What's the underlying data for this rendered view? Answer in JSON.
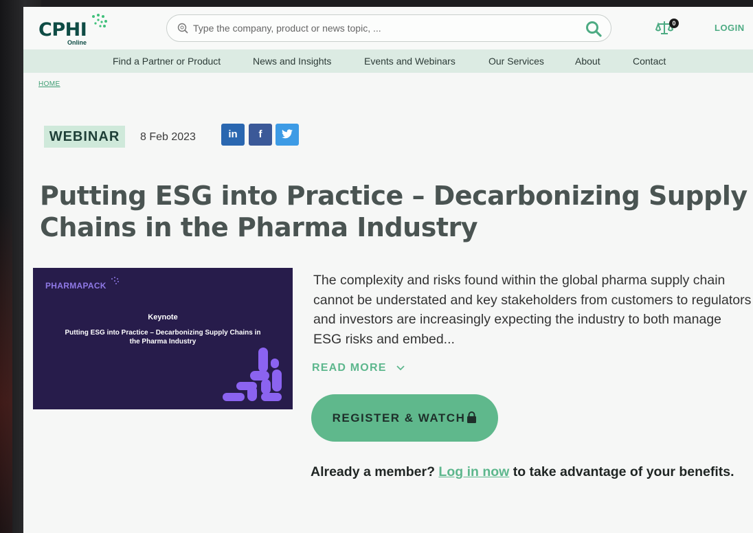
{
  "header": {
    "logo_text": "CPHI",
    "logo_sub": "Online",
    "search_placeholder": "Type the company, product or news topic, ...",
    "cart_count": "0",
    "login_label": "LOGIN"
  },
  "nav": {
    "items": [
      {
        "label": "Find a Partner or Product"
      },
      {
        "label": "News and Insights"
      },
      {
        "label": "Events and Webinars"
      },
      {
        "label": "Our Services"
      },
      {
        "label": "About"
      },
      {
        "label": "Contact"
      }
    ]
  },
  "breadcrumb": {
    "home": "HOME"
  },
  "article": {
    "tag": "WEBINAR",
    "date": "8 Feb 2023",
    "share": {
      "linkedin": "in",
      "facebook": "f"
    },
    "title": "Putting ESG into Practice – Decarbonizing Supply Chains in the Pharma Industry",
    "thumbnail": {
      "brand": "PHARMAPACK",
      "kicker": "Keynote",
      "title": "Putting ESG into Practice – Decarbonizing Supply Chains in the Pharma Industry"
    },
    "description": "The complexity and risks found within the global pharma supply chain cannot be understated and key stakeholders from customers to regulators and investors are increasingly expecting the industry to both manage ESG risks and embed...",
    "read_more": "READ MORE",
    "register_label": "REGISTER & WATCH",
    "member_prefix": "Already a member?",
    "member_link": "Log in now",
    "member_suffix": "to take advantage of your benefits."
  },
  "colors": {
    "brand_dark": "#0f4c45",
    "accent_green": "#5fb88c",
    "nav_bg": "#dcebe3",
    "thumb_bg": "#271c4b",
    "thumb_accent": "#8f79e6"
  },
  "icons": [
    "search-icon",
    "magnifier-button-icon",
    "cart-scale-icon",
    "linkedin-icon",
    "facebook-icon",
    "twitter-icon",
    "chevron-down-icon",
    "lock-icon"
  ]
}
